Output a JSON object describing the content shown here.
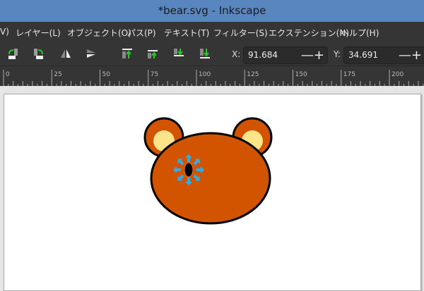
{
  "window": {
    "title": "*bear.svg - Inkscape"
  },
  "menu": [
    "V)",
    "レイヤー(L)",
    "オブジェクト(O)",
    "パス(P)",
    "テキスト(T)",
    "フィルター(S)",
    "エクステンション(N)",
    "ヘルプ(H)"
  ],
  "toolbar": {
    "icons": [
      "rotate-ccw-icon",
      "rotate-cw-icon",
      "flip-horizontal-icon",
      "flip-vertical-icon",
      "raise-to-top-icon",
      "raise-icon",
      "lower-icon",
      "lower-to-bottom-icon"
    ],
    "x_label": "X:",
    "x_value": "91.684",
    "y_label": "Y:",
    "y_value": "34.691",
    "minus": "—",
    "plus": "+"
  },
  "ruler": {
    "labels": [
      "0",
      "25",
      "50",
      "75",
      "100",
      "125",
      "150",
      "175",
      "200"
    ]
  },
  "colors": {
    "accent": "#5a86c0",
    "bear_fill": "#d35400",
    "ear_inner": "#fde38a",
    "handle": "#2eaee8"
  }
}
